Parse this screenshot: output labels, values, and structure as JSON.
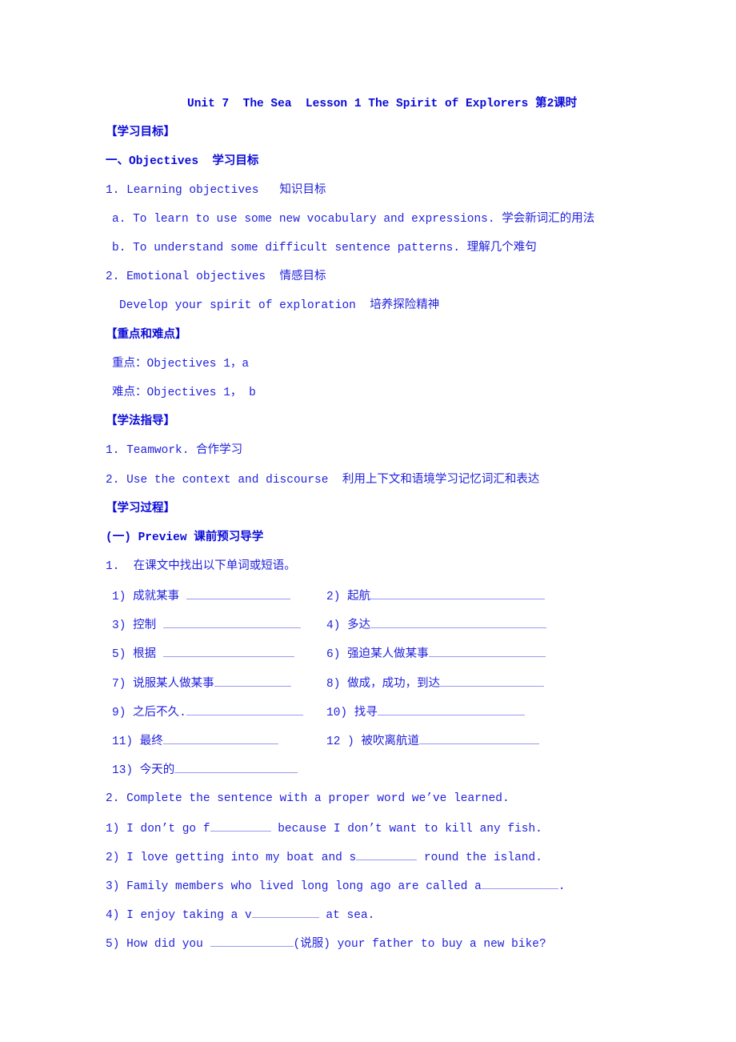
{
  "title": "Unit 7  The Sea  Lesson 1 The Spirit of Explorers 第2课时",
  "sections": {
    "goals_heading": "【学习目标】",
    "objectives_heading": "一、Objectives  学习目标",
    "obj1": "1. Learning objectives   知识目标",
    "obj1a": "a. To learn to use some new vocabulary and expressions. 学会新词汇的用法",
    "obj1b": "b. To understand some difficult sentence patterns. 理解几个难句",
    "obj2": "2. Emotional objectives  情感目标",
    "obj2_text": "Develop your spirit of exploration  培养探险精神",
    "key_heading": "【重点和难点】",
    "key_point": "重点：Objectives 1，a",
    "difficult_point": "难点：Objectives 1， b",
    "method_heading": "【学法指导】",
    "method1": "1. Teamwork. 合作学习",
    "method2": "2. Use the context and discourse  利用上下文和语境学习记忆词汇和表达",
    "process_heading": "【学习过程】",
    "preview_heading": "(一) Preview 课前预习导学",
    "task1": "1.  在课文中找出以下单词或短语。"
  },
  "vocab": [
    {
      "label": "1) 成就某事 "
    },
    {
      "label": "2) 起航"
    },
    {
      "label": "3) 控制 "
    },
    {
      "label": "4) 多达"
    },
    {
      "label": "5) 根据 "
    },
    {
      "label": "6) 强迫某人做某事"
    },
    {
      "label": "7) 说服某人做某事"
    },
    {
      "label": "8) 做成，成功，到达"
    },
    {
      "label": "9) 之后不久."
    },
    {
      "label": "10) 找寻"
    },
    {
      "label": "11) 最终"
    },
    {
      "label": "12 ) 被吹离航道"
    },
    {
      "label": "13) 今天的"
    }
  ],
  "task2": "2. Complete the sentence with a proper word we’ve learned.",
  "sentences": [
    {
      "before": "1) I don’t go f",
      "after": " because I don’t want to kill any fish."
    },
    {
      "before": "2) I love getting into my boat and s",
      "after": " round the island."
    },
    {
      "before": "3) Family members who lived long long ago are called a",
      "after": "."
    },
    {
      "before": "4) I enjoy taking a v",
      "after": " at sea."
    },
    {
      "before": "5) How did you ",
      "after": "(说服) your father to buy a new bike?"
    }
  ]
}
